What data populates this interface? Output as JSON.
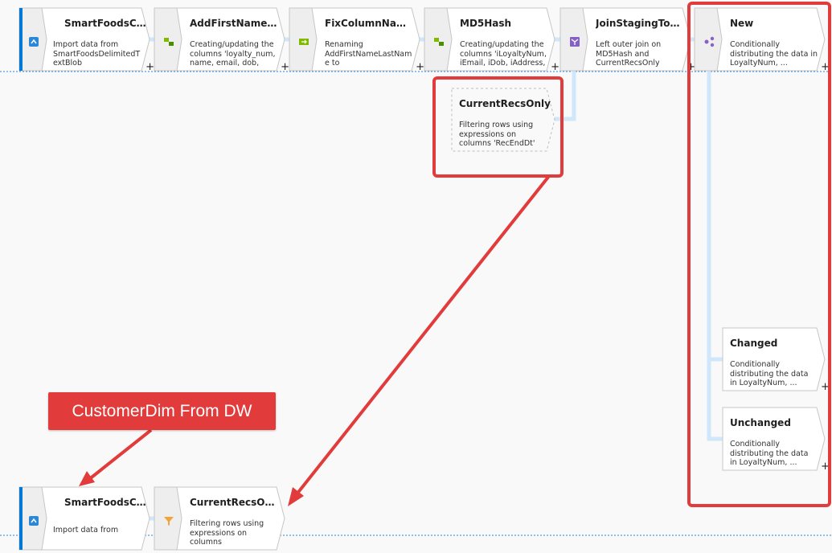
{
  "colors": {
    "connector": "#cfe6fb",
    "highlight": "#e23b3b",
    "source_bar": "#0078d4",
    "node_fill": "#ffffff",
    "node_border": "#c8c6c4",
    "icon_tab": "#eeeeee"
  },
  "nodes": [
    {
      "id": "src1",
      "title": "SmartFoodsCusto...",
      "desc": "Import data from SmartFoodsDelimitedTextBlob",
      "icon": "source-file-icon",
      "plus": "+"
    },
    {
      "id": "derived1",
      "title": "AddFirstNameLas...",
      "desc": "Creating/updating the columns 'loyalty_num, name, email, dob, address...",
      "icon": "derived-column-icon",
      "plus": "+"
    },
    {
      "id": "select1",
      "title": "FixColumnNames...",
      "desc": "Renaming AddFirstNameLastName to FixColumnNames...",
      "icon": "select-icon",
      "plus": "+"
    },
    {
      "id": "derived2",
      "title": "MD5Hash",
      "desc": "Creating/updating the columns 'iLoyaltyNum, iEmail, iDob, iAddress, iCity, iState...",
      "icon": "derived-column-icon",
      "plus": "+"
    },
    {
      "id": "join1",
      "title": "JoinStagingToDW...",
      "desc": "Left outer join on MD5Hash and CurrentRecsOnly",
      "icon": "join-icon",
      "plus": "+"
    },
    {
      "id": "split1",
      "title": "New",
      "desc": "Conditionally distributing the data in LoyaltyNum, ...",
      "icon": "conditional-split-icon",
      "plus": "+"
    },
    {
      "id": "changed",
      "title": "Changed",
      "desc": "Conditionally distributing the data in LoyaltyNum, ...",
      "icon": "",
      "plus": "+"
    },
    {
      "id": "unchanged",
      "title": "Unchanged",
      "desc": "Conditionally distributing the data in LoyaltyNum, ...",
      "icon": "",
      "plus": "+"
    },
    {
      "id": "src2",
      "title": "SmartFoodsCusto...",
      "desc": "Import data from",
      "icon": "source-table-icon",
      "plus": ""
    },
    {
      "id": "filter1",
      "title": "CurrentRecsOnly",
      "desc": "Filtering rows using expressions on columns",
      "icon": "filter-icon",
      "plus": ""
    }
  ],
  "ghost": {
    "title": "CurrentRecsOnly",
    "desc": "Filtering rows using expressions on columns 'RecEndDt'"
  },
  "callout": {
    "text": "CustomerDim From DW"
  }
}
